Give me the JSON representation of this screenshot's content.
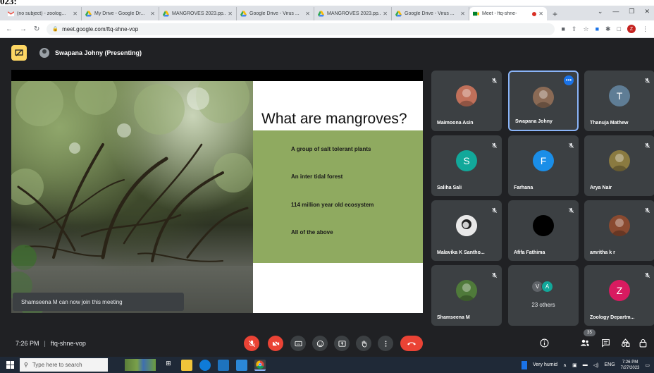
{
  "colors": {
    "accent": "#1a73e8",
    "danger": "#ea4335",
    "tile_bg": "#3c4043",
    "meet_bg": "#202124",
    "slide_green": "#8faa60"
  },
  "top_strip": {
    "text": "023:"
  },
  "browser": {
    "tabs": [
      {
        "label": "(no subject) - zoolog...",
        "icon": "gmail-icon"
      },
      {
        "label": "My Drive - Google Dr...",
        "icon": "drive-icon"
      },
      {
        "label": "MANGROVES 2023.pp...",
        "icon": "drive-icon"
      },
      {
        "label": "Google Drive - Virus ...",
        "icon": "drive-icon"
      },
      {
        "label": "MANGROVES 2023.pp...",
        "icon": "drive-icon"
      },
      {
        "label": "Google Drive - Virus ...",
        "icon": "drive-icon"
      },
      {
        "label": "Meet - ftq-shne-",
        "icon": "meet-icon",
        "active": true
      }
    ],
    "url": "meet.google.com/ftq-shne-vop",
    "profile_initial": "Z"
  },
  "meet": {
    "presenter_label": "Swapana Johny (Presenting)",
    "slide": {
      "title": "What are mangroves?",
      "bullets": [
        "A group of salt tolerant plants",
        "An inter tidal forest",
        "114 million year old ecosystem",
        "All of the above"
      ]
    },
    "toast": "Shamseena M can now join this meeting",
    "participants": [
      {
        "name": "Maimoona Asin",
        "avatar_color": "#c0705a",
        "initial": "",
        "muted": true
      },
      {
        "name": "Swapana Johny",
        "avatar_color": "#8a6a55",
        "initial": "",
        "muted": false,
        "active": true
      },
      {
        "name": "Thanuja Mathew",
        "avatar_color": "#5f7d95",
        "initial": "T",
        "muted": true
      },
      {
        "name": "Saliha Sali",
        "avatar_color": "#12a89a",
        "initial": "S",
        "muted": true
      },
      {
        "name": "Farhana",
        "avatar_color": "#1a8ee8",
        "initial": "F",
        "muted": true
      },
      {
        "name": "Arya Nair",
        "avatar_color": "#8a7a40",
        "initial": "",
        "muted": true
      },
      {
        "name": "Malavika K Santho...",
        "avatar_color": "#e0e0e0",
        "initial": "",
        "muted": true
      },
      {
        "name": "Afifa Fathima",
        "avatar_color": "#000000",
        "initial": "",
        "muted": true
      },
      {
        "name": "amritha k r",
        "avatar_color": "#8a4a30",
        "initial": "",
        "muted": true
      },
      {
        "name": "Shamseena M",
        "avatar_color": "#4f7a3a",
        "initial": "",
        "muted": true
      },
      {
        "name": "",
        "others": "23 others",
        "mini": [
          {
            "initial": "V",
            "color": "#5f6368"
          },
          {
            "initial": "A",
            "color": "#12a89a"
          }
        ]
      },
      {
        "name": "Zoology Departm...",
        "avatar_color": "#d81b60",
        "initial": "Z",
        "muted": true
      }
    ],
    "time": "7:26 PM",
    "code": "ftq-shne-vop",
    "people_count": "35"
  },
  "taskbar": {
    "search_placeholder": "Type here to search",
    "weather": "Very humid",
    "lang": "ENG",
    "clock_time": "7:26 PM",
    "clock_date": "7/27/2023"
  }
}
